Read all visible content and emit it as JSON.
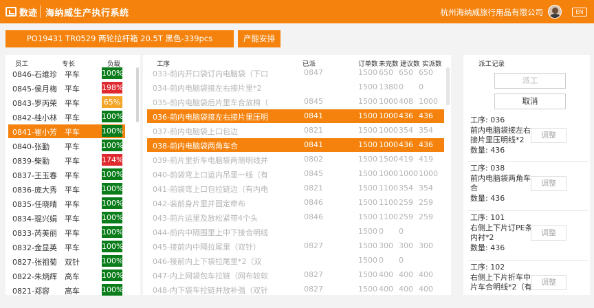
{
  "header": {
    "logo_text": "数迹",
    "system_title": "海纳威生产执行系统",
    "company": "杭州海纳威旅行用品有限公司",
    "lang": "EN"
  },
  "order": {
    "label": "PO19431 TR0529 两轮拉杆箱 20.5T 黑色-339pcs",
    "capacity_btn": "产能安排"
  },
  "employees": {
    "headers": [
      "员工",
      "专长",
      "负载"
    ],
    "rows": [
      {
        "name": "0846-石维珍",
        "skill": "平车",
        "load": "100%",
        "color": "#0a7d1a"
      },
      {
        "name": "0845-侯月梅",
        "skill": "平车",
        "load": "198%",
        "color": "#e0292e"
      },
      {
        "name": "0843-罗丙荣",
        "skill": "平车",
        "load": "65%",
        "color": "#f2a526"
      },
      {
        "name": "0842-桂小林",
        "skill": "平车",
        "load": "100%",
        "color": "#0a7d1a"
      },
      {
        "name": "0841-崔小芳",
        "skill": "平车",
        "load": "100%",
        "color": "#0a7d1a",
        "selected": true
      },
      {
        "name": "0840-张勤",
        "skill": "平车",
        "load": "100%",
        "color": "#0a7d1a"
      },
      {
        "name": "0839-柴勤",
        "skill": "平车",
        "load": "174%",
        "color": "#e0292e"
      },
      {
        "name": "0837-王玉春",
        "skill": "平车",
        "load": "100%",
        "color": "#0a7d1a"
      },
      {
        "name": "0836-庞大秀",
        "skill": "平车",
        "load": "100%",
        "color": "#0a7d1a"
      },
      {
        "name": "0835-任晓晴",
        "skill": "平车",
        "load": "100%",
        "color": "#0a7d1a"
      },
      {
        "name": "0834-琨兴娟",
        "skill": "平车",
        "load": "100%",
        "color": "#0a7d1a"
      },
      {
        "name": "0833-芮美丽",
        "skill": "平车",
        "load": "100%",
        "color": "#0a7d1a"
      },
      {
        "name": "0832-金显英",
        "skill": "平车",
        "load": "100%",
        "color": "#0a7d1a"
      },
      {
        "name": "0827-张祖菊",
        "skill": "双针",
        "load": "100%",
        "color": "#0a7d1a"
      },
      {
        "name": "0822-朱炳辉",
        "skill": "高车",
        "load": "100%",
        "color": "#0a7d1a"
      },
      {
        "name": "0821-郑容",
        "skill": "高车",
        "load": "100%",
        "color": "#0a7d1a"
      }
    ]
  },
  "processes": {
    "headers": [
      "工序",
      "已派",
      "订单数",
      "未完数",
      "建议数",
      "实派数"
    ],
    "rows": [
      {
        "name": "033-前内开口袋订内电脑袋（下口",
        "dept": "0847",
        "n1": "1500",
        "n2": "650",
        "n3": "650",
        "n4": "650"
      },
      {
        "name": "034-前内电脑袋接左右接片里*2",
        "dept": "",
        "n1": "1500",
        "n2": "1380",
        "n3": "0",
        "n4": "0"
      },
      {
        "name": "035-前内电脑袋后片里车合放棉（",
        "dept": "0845",
        "n1": "1500",
        "n2": "1000",
        "n3": "408",
        "n4": "1000"
      },
      {
        "name": "036-前内电脑袋接左右接片里压明",
        "dept": "0841",
        "n1": "1500",
        "n2": "1000",
        "n3": "436",
        "n4": "436",
        "selected": true
      },
      {
        "name": "037-前内电脑袋上口包边",
        "dept": "0821",
        "n1": "1500",
        "n2": "1000",
        "n3": "354",
        "n4": "354"
      },
      {
        "name": "038-前内电脑袋两角车合",
        "dept": "0841",
        "n1": "1500",
        "n2": "1000",
        "n3": "436",
        "n4": "436",
        "selected": true
      },
      {
        "name": "039-前片里折车电脑袋两侧明线并",
        "dept": "0802",
        "n1": "1500",
        "n2": "1500",
        "n3": "419",
        "n4": "419"
      },
      {
        "name": "040-前袋弯上口运内吊里一线（有",
        "dept": "0845",
        "n1": "1500",
        "n2": "1000",
        "n3": "1000",
        "n4": "1000"
      },
      {
        "name": "041-前袋弯上口包拉链边（有内电",
        "dept": "0821",
        "n1": "1500",
        "n2": "1100",
        "n3": "354",
        "n4": "354"
      },
      {
        "name": "042-装前身片里并固定牵布",
        "dept": "0846",
        "n1": "1500",
        "n2": "1100",
        "n3": "259",
        "n4": "259"
      },
      {
        "name": "043-前片运里及放松紧带4个头",
        "dept": "0846",
        "n1": "1500",
        "n2": "1100",
        "n3": "259",
        "n4": "259"
      },
      {
        "name": "044-前内中隔围里上中下接合明线",
        "dept": "",
        "n1": "1500",
        "n2": "0",
        "n3": "0",
        "n4": ""
      },
      {
        "name": "045-接前内中隔拉尾里（双针）",
        "dept": "0827",
        "n1": "1500",
        "n2": "300",
        "n3": "300",
        "n4": "300"
      },
      {
        "name": "046-接前内上下袋拉尾里*2（双",
        "dept": "",
        "n1": "1500",
        "n2": "0",
        "n3": "0",
        "n4": ""
      },
      {
        "name": "047-内上网袋包车拉链（网布较软",
        "dept": "0827",
        "n1": "1500",
        "n2": "400",
        "n3": "400",
        "n4": "400"
      },
      {
        "name": "048-内下袋车拉链并放补强（双针",
        "dept": "0827",
        "n1": "1500",
        "n2": "400",
        "n3": "400",
        "n4": "400"
      }
    ]
  },
  "records": {
    "title": "派工记录",
    "dispatch_btn": "派工",
    "cancel_btn": "取消",
    "adjust_label": "调整",
    "items": [
      {
        "text": "工序: 036\n前内电脑袋接左右接片里压明线*2\n数量: 436"
      },
      {
        "text": "工序: 038\n前内电脑袋两角车合\n数量: 436"
      },
      {
        "text": "工序: 101\n右侧上下片订PE条内衬*2\n数量: 436"
      },
      {
        "text": "工序: 102\n右侧上下片折车中片车合明线*2（有"
      }
    ]
  }
}
